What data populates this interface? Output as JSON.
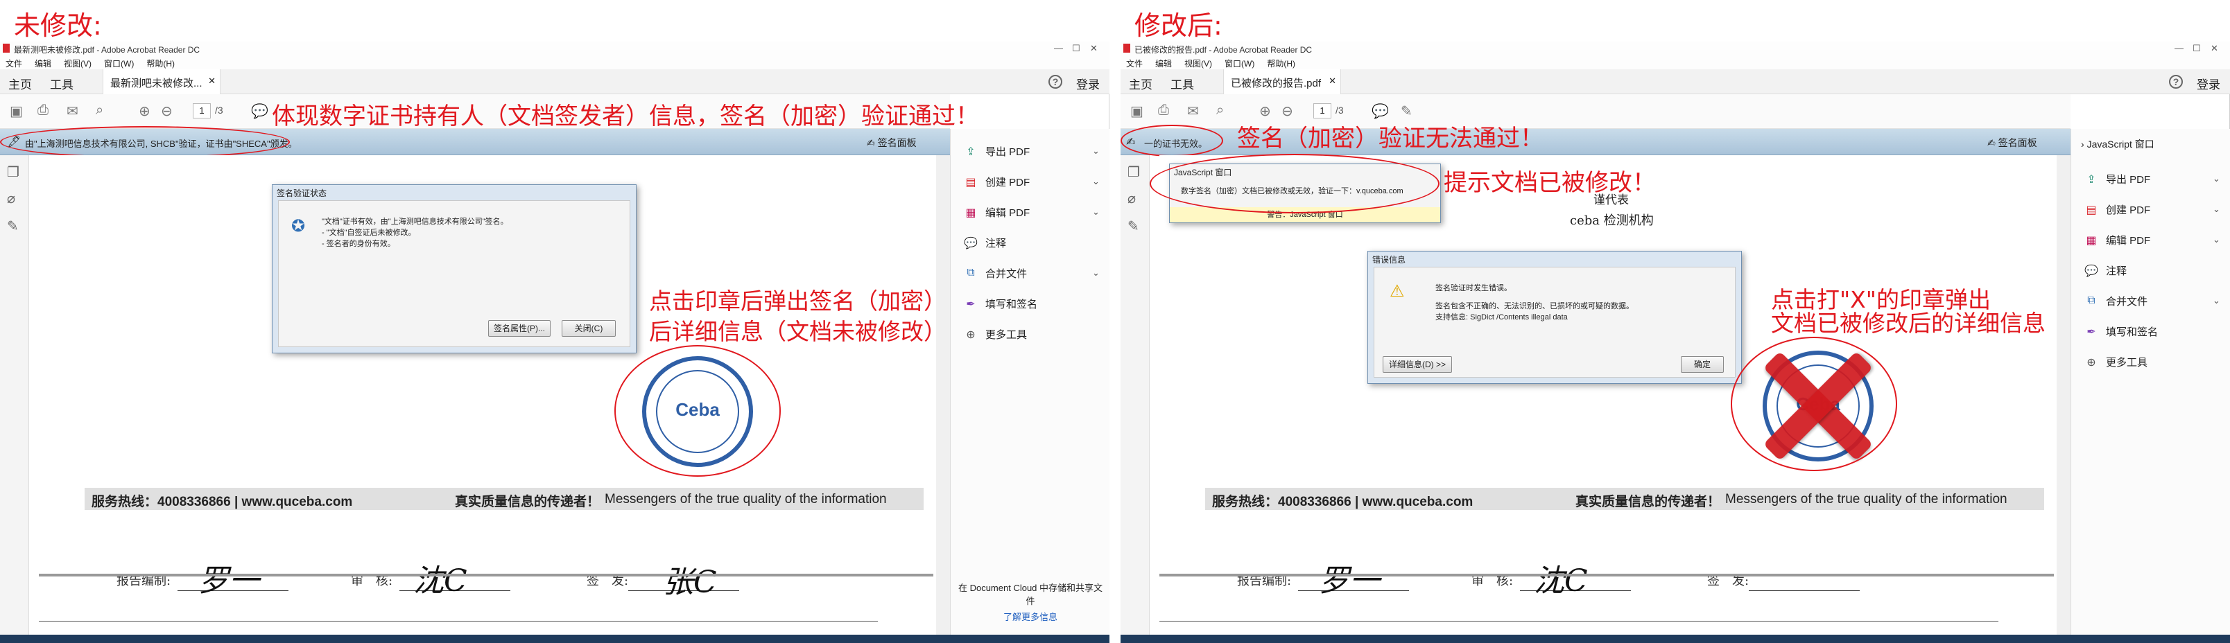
{
  "colors": {
    "annotation": "#e1191f",
    "sigbar": "#b8cfe3",
    "stamp": "#2f5fa6",
    "cross": "#d11a1f"
  },
  "left": {
    "caption": "未修改:",
    "window_title": "最新测吧未被修改.pdf - Adobe Acrobat Reader DC",
    "menu": [
      "文件",
      "编辑",
      "视图(V)",
      "窗口(W)",
      "帮助(H)"
    ],
    "tabs": {
      "home": "主页",
      "tools": "工具",
      "doc": "最新测吧未被修改...",
      "signin": "登录"
    },
    "page_current": "1",
    "page_total": "/3",
    "sig_message": "由\"上海测吧信息技术有限公司, SHCB\"验证，证书由\"SHECA\"颁发。",
    "sig_panel": "签名面板",
    "annotation_top": "体现数字证书持有人（文档签发者）信息，签名（加密）验证通过！",
    "annotation_side_1": "点击印章后弹出签名（加密）",
    "annotation_side_2": "后详细信息（文档未被修改）！",
    "dialog": {
      "title": "签名验证状态",
      "line1": "\"文档\"证书有效，由\"上海测吧信息技术有限公司\"签名。",
      "line2": "- \"文档\"自签证后未被修改。",
      "line3": "- 签名者的身份有效。",
      "btn_props": "签名属性(P)...",
      "btn_close": "关闭(C)"
    },
    "right_pane": [
      "导出 PDF",
      "创建 PDF",
      "编辑 PDF",
      "注释",
      "合并文件",
      "填写和签名",
      "更多工具"
    ],
    "cloud_text": "在 Document Cloud 中存储和共享文件",
    "cloud_link": "了解更多信息",
    "sig_labels": {
      "editor": "报告编制:",
      "review": "审　核:",
      "issue": "签　发:"
    },
    "stamp_text": "Ceba",
    "footer": {
      "hotline": "服务热线：4008336866 | www.quceba.com",
      "slogan": "真实质量信息的传递者！",
      "english": "Messengers of the true quality of the information"
    }
  },
  "right": {
    "caption": "修改后:",
    "window_title": "已被修改的报告.pdf - Adobe Acrobat Reader DC",
    "menu": [
      "文件",
      "编辑",
      "视图(V)",
      "窗口(W)",
      "帮助(H)"
    ],
    "tabs": {
      "home": "主页",
      "tools": "工具",
      "doc": "已被修改的报告.pdf",
      "signin": "登录"
    },
    "page_current": "1",
    "page_total": "/3",
    "sig_message": "一的证书无效。",
    "sig_panel": "签名面板",
    "annotation_top": "签名（加密）验证无法通过！",
    "annotation_modified": "提示文档已被修改！",
    "annotation_side_1": "点击打\"X\"的印章弹出",
    "annotation_side_2": "文档已被修改后的详细信息",
    "js_window": {
      "title": "JavaScript 窗口",
      "message": "数字签名（加密）文档已被修改或无效，验证一下：v.quceba.com",
      "warning": "警告：JavaScript 窗口"
    },
    "doc_header": {
      "line1": "谨代表",
      "line2": "ceba 检测机构"
    },
    "error_dialog": {
      "title": "错误信息",
      "line1": "签名验证时发生错误。",
      "line2": "签名包含不正确的、无法识别的、已损坏的或可疑的数据。",
      "line3": "支持信息: SigDict /Contents illegal data",
      "btn_details": "详细信息(D) >>",
      "btn_ok": "确定"
    },
    "right_pane_header": "JavaScript 窗口",
    "right_pane": [
      "导出 PDF",
      "创建 PDF",
      "编辑 PDF",
      "注释",
      "合并文件",
      "填写和签名",
      "更多工具"
    ],
    "sig_labels": {
      "editor": "报告编制:",
      "review": "审　核:",
      "issue": "签　发:"
    },
    "stamp_text": "Ceba",
    "footer": {
      "hotline": "服务热线：4008336866 | www.quceba.com",
      "slogan": "真实质量信息的传递者！",
      "english": "Messengers of the true quality of the information"
    }
  }
}
